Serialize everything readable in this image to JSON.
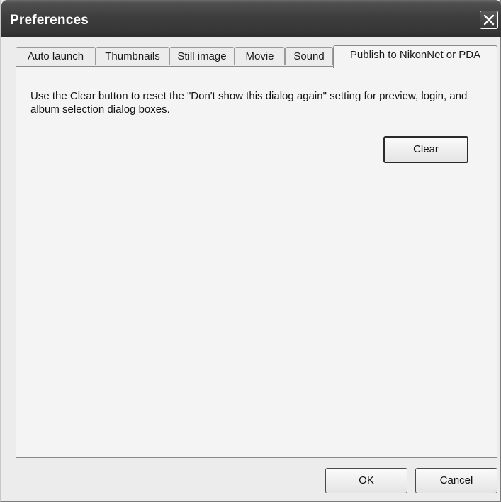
{
  "window": {
    "title": "Preferences"
  },
  "tabs": [
    {
      "label": "Auto launch",
      "active": false
    },
    {
      "label": "Thumbnails",
      "active": false
    },
    {
      "label": "Still image",
      "active": false
    },
    {
      "label": "Movie",
      "active": false
    },
    {
      "label": "Sound",
      "active": false
    },
    {
      "label": "Publish to NikonNet or PDA",
      "active": true
    }
  ],
  "panel": {
    "description": "Use the Clear button to reset the \"Don't show this dialog again\" setting for preview, login, and album selection dialog boxes.",
    "clear_label": "Clear"
  },
  "footer": {
    "ok_label": "OK",
    "cancel_label": "Cancel"
  },
  "icons": {
    "close": "close-icon"
  }
}
